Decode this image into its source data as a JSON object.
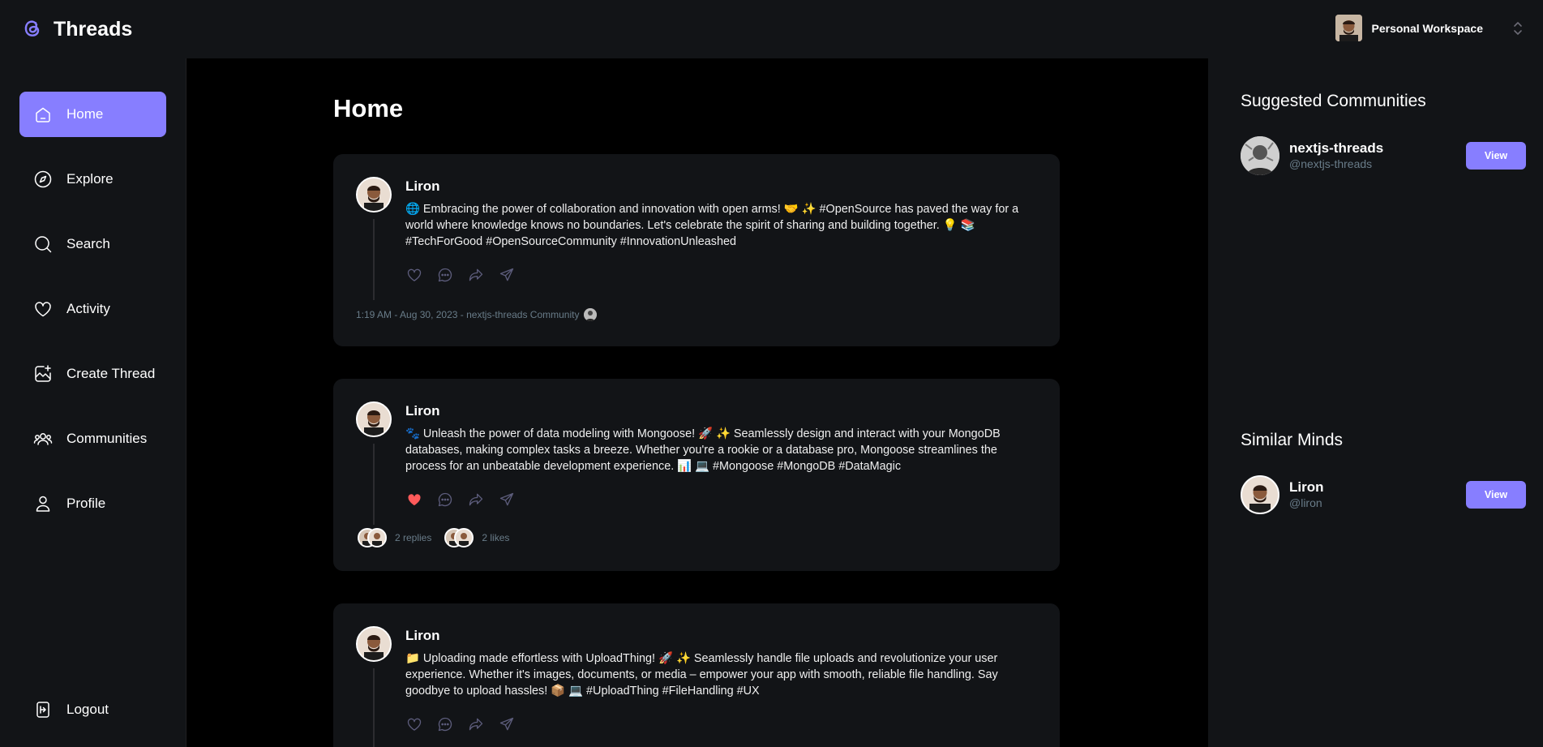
{
  "brand": {
    "name": "Threads",
    "logo_icon": "threads-logo-icon"
  },
  "workspace": {
    "name": "Personal Workspace"
  },
  "nav": {
    "items": [
      {
        "label": "Home",
        "icon": "home-icon",
        "active": true
      },
      {
        "label": "Explore",
        "icon": "compass-icon"
      },
      {
        "label": "Search",
        "icon": "search-icon"
      },
      {
        "label": "Activity",
        "icon": "heart-icon"
      },
      {
        "label": "Create Thread",
        "icon": "image-plus-icon"
      },
      {
        "label": "Communities",
        "icon": "users-icon"
      },
      {
        "label": "Profile",
        "icon": "user-icon"
      }
    ],
    "logout": "Logout"
  },
  "main": {
    "title": "Home",
    "threads": [
      {
        "author": "Liron",
        "text": "🌐 Embracing the power of collaboration and innovation with open arms! 🤝 ✨ #OpenSource has paved the way for a world where knowledge knows no boundaries. Let's celebrate the spirit of sharing and building together. 💡 📚 #TechForGood #OpenSourceCommunity #InnovationUnleashed",
        "liked": false,
        "meta": "1:19 AM - Aug 30, 2023 - nextjs-threads Community"
      },
      {
        "author": "Liron",
        "text": "🐾 Unleash the power of data modeling with Mongoose! 🚀 ✨ Seamlessly design and interact with your MongoDB databases, making complex tasks a breeze. Whether you're a rookie or a database pro, Mongoose streamlines the process for an unbeatable development experience. 📊 💻 #Mongoose #MongoDB #DataMagic",
        "liked": true,
        "replies": "2 replies",
        "likes": "2 likes"
      },
      {
        "author": "Liron",
        "text": "📁 Uploading made effortless with UploadThing! 🚀 ✨ Seamlessly handle file uploads and revolutionize your user experience. Whether it's images, documents, or media – empower your app with smooth, reliable file handling. Say goodbye to upload hassles! 📦 💻 #UploadThing #FileHandling #UX",
        "liked": false
      }
    ]
  },
  "right": {
    "communities_title": "Suggested Communities",
    "communities": [
      {
        "name": "nextjs-threads",
        "handle": "@nextjs-threads",
        "button": "View"
      }
    ],
    "minds_title": "Similar Minds",
    "minds": [
      {
        "name": "Liron",
        "handle": "@liron",
        "button": "View"
      }
    ]
  },
  "colors": {
    "accent": "#877eff",
    "bg": "#121417",
    "main_bg": "#000000",
    "muted": "#697c89",
    "like": "#ff5a5a"
  }
}
